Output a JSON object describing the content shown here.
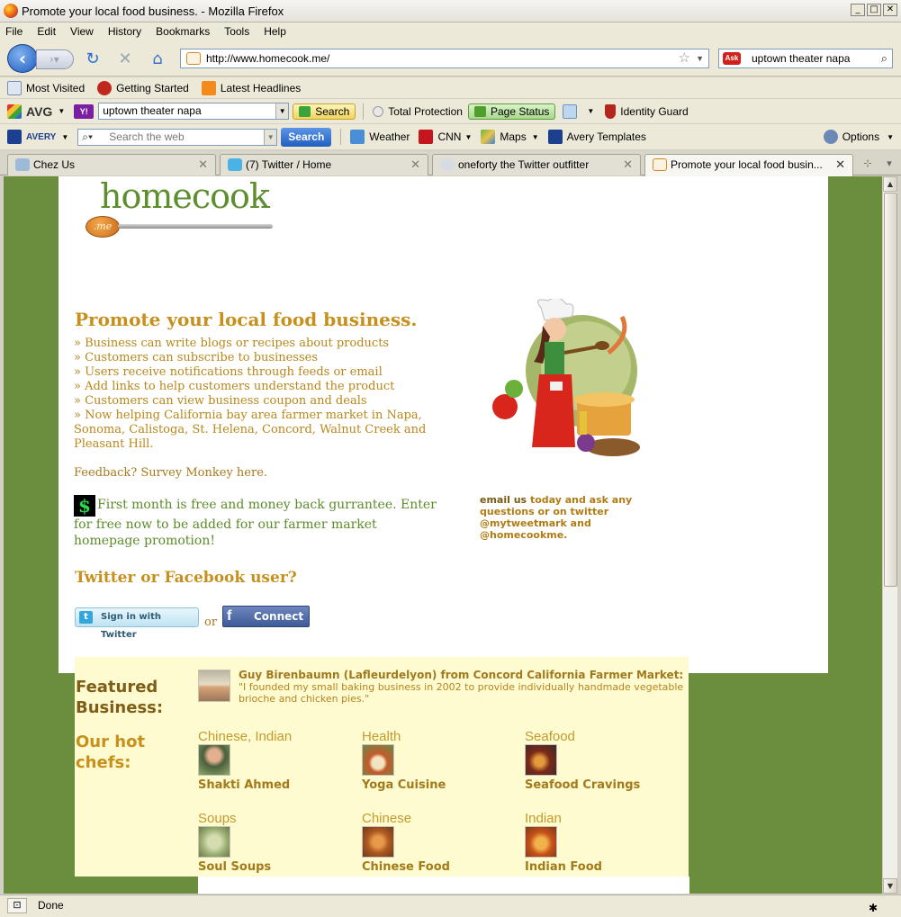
{
  "window": {
    "title": "Promote your local food business. - Mozilla Firefox"
  },
  "menu": [
    "File",
    "Edit",
    "View",
    "History",
    "Bookmarks",
    "Tools",
    "Help"
  ],
  "nav": {
    "url": "http://www.homecook.me/",
    "search_value": "uptown theater napa"
  },
  "bookmarks": [
    "Most Visited",
    "Getting Started",
    "Latest Headlines"
  ],
  "avg_toolbar": {
    "brand": "AVG",
    "search_value": "uptown theater napa",
    "search_button": "Search",
    "total_protection": "Total Protection",
    "page_status": "Page Status",
    "identity_guard": "Identity Guard"
  },
  "ask_toolbar": {
    "brand": "AVERY",
    "placeholder": "Search the web",
    "search_button": "Search",
    "weather": "Weather",
    "cnn": "CNN",
    "maps": "Maps",
    "avery_templates": "Avery Templates",
    "options": "Options"
  },
  "tabs": [
    {
      "label": "Chez Us",
      "active": false
    },
    {
      "label": "(7) Twitter / Home",
      "active": false
    },
    {
      "label": "oneforty the Twitter outfitter",
      "active": false
    },
    {
      "label": "Promote your local food busin...",
      "active": true
    }
  ],
  "page": {
    "logo_text": "homecook",
    "logo_badge": ".me",
    "headline": "Promote your local food business.",
    "bullets": [
      "»  Business can write blogs or recipes about products",
      "»  Customers can subscribe to businesses",
      "»  Users receive notifications through feeds or email",
      "»  Add links to help customers understand the product",
      "»  Customers can view business coupon and deals",
      "»  Now helping California bay area farmer market in Napa, Sonoma, Calistoga, St. Helena, Concord, Walnut Creek and Pleasant Hill."
    ],
    "feedback": "Feedback? Survey Monkey here.",
    "promo": "First month is free and money back gurrantee. Enter for free now to be added for our farmer market homepage promotion!",
    "dollar": "$",
    "twitter_heading": "Twitter or Facebook user?",
    "twitter_button": "Sign in with Twitter",
    "or": "or",
    "facebook_button": "Connect",
    "email_prefix": "email us",
    "email_text": " today and ask any questions or on twitter @mytweetmark and @homecookme."
  },
  "featured": {
    "label": "Featured Business:",
    "name_line": "Guy Birenbaumn (Lafleurdelyon) from Concord California Farmer Market:",
    "quote": "\"I founded my small baking business in 2002 to provide individually handmade vegetable brioche and chicken pies.\""
  },
  "hot_chefs": {
    "label": "Our hot chefs:",
    "chefs": [
      {
        "category": "Chinese, Indian",
        "name": "Shakti Ahmed",
        "color": "#6a8a4c"
      },
      {
        "category": "Health",
        "name": "Yoga Cuisine",
        "color": "#8a9a5a"
      },
      {
        "category": "Seafood",
        "name": "Seafood Cravings",
        "color": "#8a4a2a"
      },
      {
        "category": "Soups",
        "name": "Soul Soups",
        "color": "#9aae72"
      },
      {
        "category": "Chinese",
        "name": "Chinese Food",
        "color": "#b05a22"
      },
      {
        "category": "Indian",
        "name": "Indian Food",
        "color": "#c6501a"
      }
    ]
  },
  "status": {
    "text": "Done"
  },
  "colors": {
    "page_green": "#6b8d3e",
    "gold": "#c7901c",
    "cream": "#fffbd0"
  }
}
